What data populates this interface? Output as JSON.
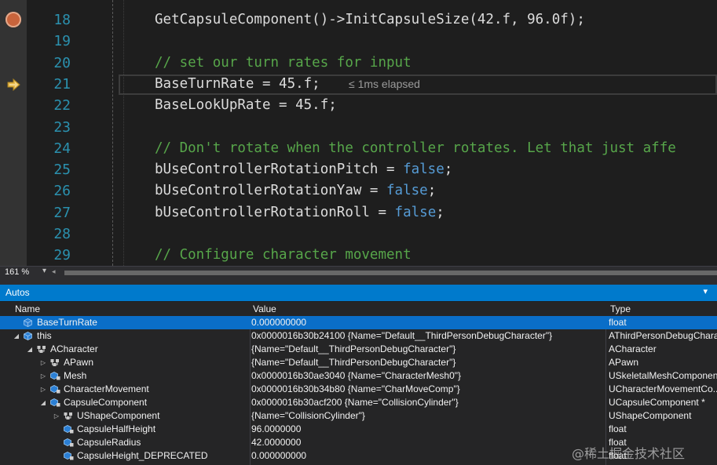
{
  "editor": {
    "lines": [
      {
        "num": "18",
        "tokens": [
          {
            "t": "GetCapsuleComponent()->InitCapsuleSize(42.f, 96.0f);",
            "c": ""
          }
        ]
      },
      {
        "num": "19",
        "tokens": []
      },
      {
        "num": "20",
        "tokens": [
          {
            "t": "// set our turn rates for input",
            "c": "cm"
          }
        ]
      },
      {
        "num": "21",
        "tokens": [
          {
            "t": "BaseTurnRate = 45.f;",
            "c": ""
          }
        ]
      },
      {
        "num": "22",
        "tokens": [
          {
            "t": "BaseLookUpRate = 45.f;",
            "c": ""
          }
        ]
      },
      {
        "num": "23",
        "tokens": []
      },
      {
        "num": "24",
        "tokens": [
          {
            "t": "// Don't rotate when the controller rotates. Let that just affe",
            "c": "cm"
          }
        ]
      },
      {
        "num": "25",
        "tokens": [
          {
            "t": "bUseControllerRotationPitch = ",
            "c": ""
          },
          {
            "t": "false",
            "c": "kw"
          },
          {
            "t": ";",
            "c": ""
          }
        ]
      },
      {
        "num": "26",
        "tokens": [
          {
            "t": "bUseControllerRotationYaw = ",
            "c": ""
          },
          {
            "t": "false",
            "c": "kw"
          },
          {
            "t": ";",
            "c": ""
          }
        ]
      },
      {
        "num": "27",
        "tokens": [
          {
            "t": "bUseControllerRotationRoll = ",
            "c": ""
          },
          {
            "t": "false",
            "c": "kw"
          },
          {
            "t": ";",
            "c": ""
          }
        ]
      },
      {
        "num": "28",
        "tokens": []
      },
      {
        "num": "29",
        "tokens": [
          {
            "t": "// Configure character movement",
            "c": "cm"
          }
        ]
      }
    ],
    "perf_tip": "≤ 1ms elapsed",
    "icons": {
      "breakpoint": "breakpoint-icon",
      "current_statement": "current-statement-arrow-icon"
    }
  },
  "status": {
    "zoom": "161 %"
  },
  "autos": {
    "title": "Autos",
    "columns": {
      "name": "Name",
      "value": "Value",
      "type": "Type"
    },
    "rows": [
      {
        "depth": 0,
        "expander": "",
        "icon": "field",
        "name": "BaseTurnRate",
        "value": "0.000000000",
        "type": "float",
        "selected": true
      },
      {
        "depth": 0,
        "expander": "open",
        "icon": "field",
        "name": "this",
        "value": "0x0000016b30b24100 {Name=\"Default__ThirdPersonDebugCharacter\"}",
        "type": "AThirdPersonDebugChara..."
      },
      {
        "depth": 1,
        "expander": "open",
        "icon": "base",
        "name": "ACharacter",
        "value": "{Name=\"Default__ThirdPersonDebugCharacter\"}",
        "type": "ACharacter"
      },
      {
        "depth": 2,
        "expander": "closed",
        "icon": "base",
        "name": "APawn",
        "value": "{Name=\"Default__ThirdPersonDebugCharacter\"}",
        "type": "APawn"
      },
      {
        "depth": 2,
        "expander": "closed",
        "icon": "field-lock",
        "name": "Mesh",
        "value": "0x0000016b30ae3040 {Name=\"CharacterMesh0\"}",
        "type": "USkeletalMeshComponen..."
      },
      {
        "depth": 2,
        "expander": "closed",
        "icon": "field-lock",
        "name": "CharacterMovement",
        "value": "0x0000016b30b34b80 {Name=\"CharMoveComp\"}",
        "type": "UCharacterMovementCo..."
      },
      {
        "depth": 2,
        "expander": "open",
        "icon": "field-lock",
        "name": "CapsuleComponent",
        "value": "0x0000016b30acf200 {Name=\"CollisionCylinder\"}",
        "type": "UCapsuleComponent *"
      },
      {
        "depth": 3,
        "expander": "closed",
        "icon": "base",
        "name": "UShapeComponent",
        "value": "{Name=\"CollisionCylinder\"}",
        "type": "UShapeComponent"
      },
      {
        "depth": 3,
        "expander": "",
        "icon": "field-lock",
        "name": "CapsuleHalfHeight",
        "value": "96.0000000",
        "type": "float"
      },
      {
        "depth": 3,
        "expander": "",
        "icon": "field-lock",
        "name": "CapsuleRadius",
        "value": "42.0000000",
        "type": "float"
      },
      {
        "depth": 3,
        "expander": "",
        "icon": "field-lock",
        "name": "CapsuleHeight_DEPRECATED",
        "value": "0.000000000",
        "type": "float"
      }
    ]
  },
  "watermark": "@稀土掘金技术社区",
  "colors": {
    "accent": "#007acc",
    "selection": "#0a6ec8",
    "comment": "#57a64a",
    "keyword": "#569cd6",
    "line_number": "#2b91af",
    "breakpoint": "#c8643c"
  }
}
